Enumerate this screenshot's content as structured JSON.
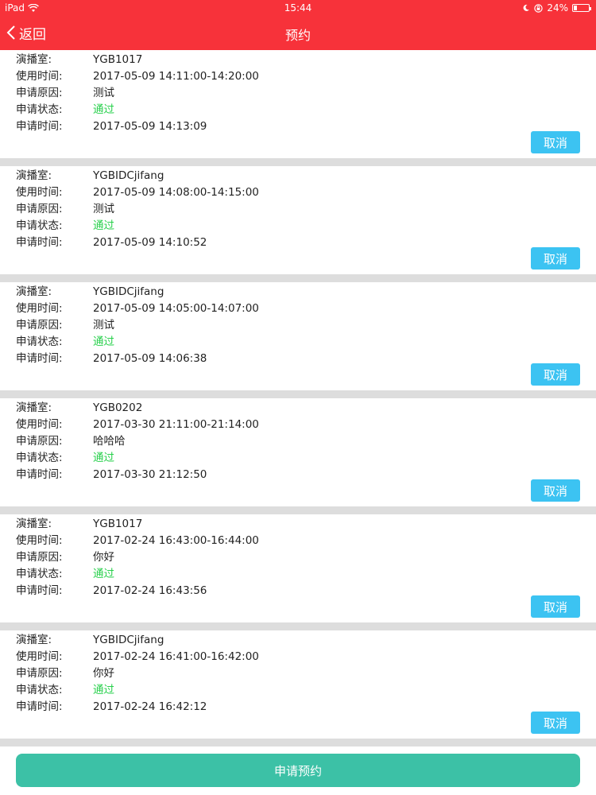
{
  "status_bar": {
    "device": "iPad",
    "time": "15:44",
    "battery": "24%",
    "battery_level": 0.24
  },
  "nav": {
    "back_label": "返回",
    "title": "预约"
  },
  "labels": {
    "room": "演播室:",
    "use_time": "使用时间:",
    "reason": "申请原因:",
    "status": "申请状态:",
    "apply_time": "申请时间:"
  },
  "reservations": [
    {
      "room": "YGB1017",
      "use_time": "2017-05-09 14:11:00-14:20:00",
      "reason": "测试",
      "status": "通过",
      "apply_time": "2017-05-09 14:13:09",
      "cancel_label": "取消"
    },
    {
      "room": "YGBIDCjifang",
      "use_time": "2017-05-09 14:08:00-14:15:00",
      "reason": "测试",
      "status": "通过",
      "apply_time": "2017-05-09 14:10:52",
      "cancel_label": "取消"
    },
    {
      "room": "YGBIDCjifang",
      "use_time": "2017-05-09 14:05:00-14:07:00",
      "reason": "测试",
      "status": "通过",
      "apply_time": "2017-05-09 14:06:38",
      "cancel_label": "取消"
    },
    {
      "room": "YGB0202",
      "use_time": "2017-03-30 21:11:00-21:14:00",
      "reason": "哈哈哈",
      "status": "通过",
      "apply_time": "2017-03-30 21:12:50",
      "cancel_label": "取消"
    },
    {
      "room": "YGB1017",
      "use_time": "2017-02-24 16:43:00-16:44:00",
      "reason": "你好",
      "status": "通过",
      "apply_time": "2017-02-24 16:43:56",
      "cancel_label": "取消"
    },
    {
      "room": "YGBIDCjifang",
      "use_time": "2017-02-24 16:41:00-16:42:00",
      "reason": "你好",
      "status": "通过",
      "apply_time": "2017-02-24 16:42:12",
      "cancel_label": "取消"
    }
  ],
  "apply_button": {
    "label": "申请预约"
  },
  "colors": {
    "header": "#f7323a",
    "status_ok": "#28d04c",
    "cancel": "#3cc3f2",
    "apply": "#3cc1a6",
    "separator": "#dddddd"
  }
}
